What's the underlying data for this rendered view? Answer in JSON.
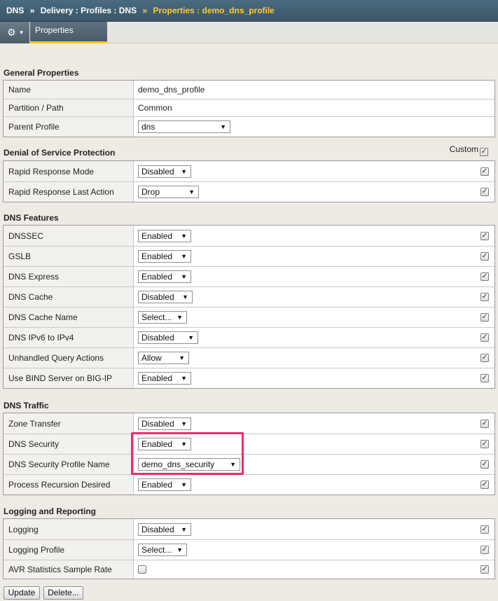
{
  "breadcrumb": {
    "items": [
      "DNS",
      "Delivery : Profiles : DNS"
    ],
    "current": "Properties : demo_dns_profile",
    "separator": "»"
  },
  "toolbar": {
    "gear_icon": "gear-icon",
    "tab_label": "Properties"
  },
  "general": {
    "title": "General Properties",
    "name_label": "Name",
    "name_value": "demo_dns_profile",
    "partition_label": "Partition / Path",
    "partition_value": "Common",
    "parent_label": "Parent Profile",
    "parent_value": "dns"
  },
  "custom_label": "Custom",
  "dos": {
    "title": "Denial of Service Protection",
    "rows": [
      {
        "label": "Rapid Response Mode",
        "value": "Disabled"
      },
      {
        "label": "Rapid Response Last Action",
        "value": "Drop"
      }
    ]
  },
  "features": {
    "title": "DNS Features",
    "rows": [
      {
        "label": "DNSSEC",
        "value": "Enabled"
      },
      {
        "label": "GSLB",
        "value": "Enabled"
      },
      {
        "label": "DNS Express",
        "value": "Enabled"
      },
      {
        "label": "DNS Cache",
        "value": "Disabled"
      },
      {
        "label": "DNS Cache Name",
        "value": "Select..."
      },
      {
        "label": "DNS IPv6 to IPv4",
        "value": "Disabled"
      },
      {
        "label": "Unhandled Query Actions",
        "value": "Allow"
      },
      {
        "label": "Use BIND Server on BIG-IP",
        "value": "Enabled"
      }
    ]
  },
  "traffic": {
    "title": "DNS Traffic",
    "rows": [
      {
        "label": "Zone Transfer",
        "value": "Disabled"
      },
      {
        "label": "DNS Security",
        "value": "Enabled"
      },
      {
        "label": "DNS Security Profile Name",
        "value": "demo_dns_security"
      },
      {
        "label": "Process Recursion Desired",
        "value": "Enabled"
      }
    ]
  },
  "logging": {
    "title": "Logging and Reporting",
    "rows": [
      {
        "label": "Logging",
        "value": "Disabled"
      },
      {
        "label": "Logging Profile",
        "value": "Select..."
      },
      {
        "label": "AVR Statistics Sample Rate",
        "value": ""
      }
    ]
  },
  "buttons": {
    "update": "Update",
    "delete": "Delete..."
  },
  "colors": {
    "accent": "#ffcc33",
    "highlight": "#ee2a6e",
    "header": "#3b5668"
  }
}
